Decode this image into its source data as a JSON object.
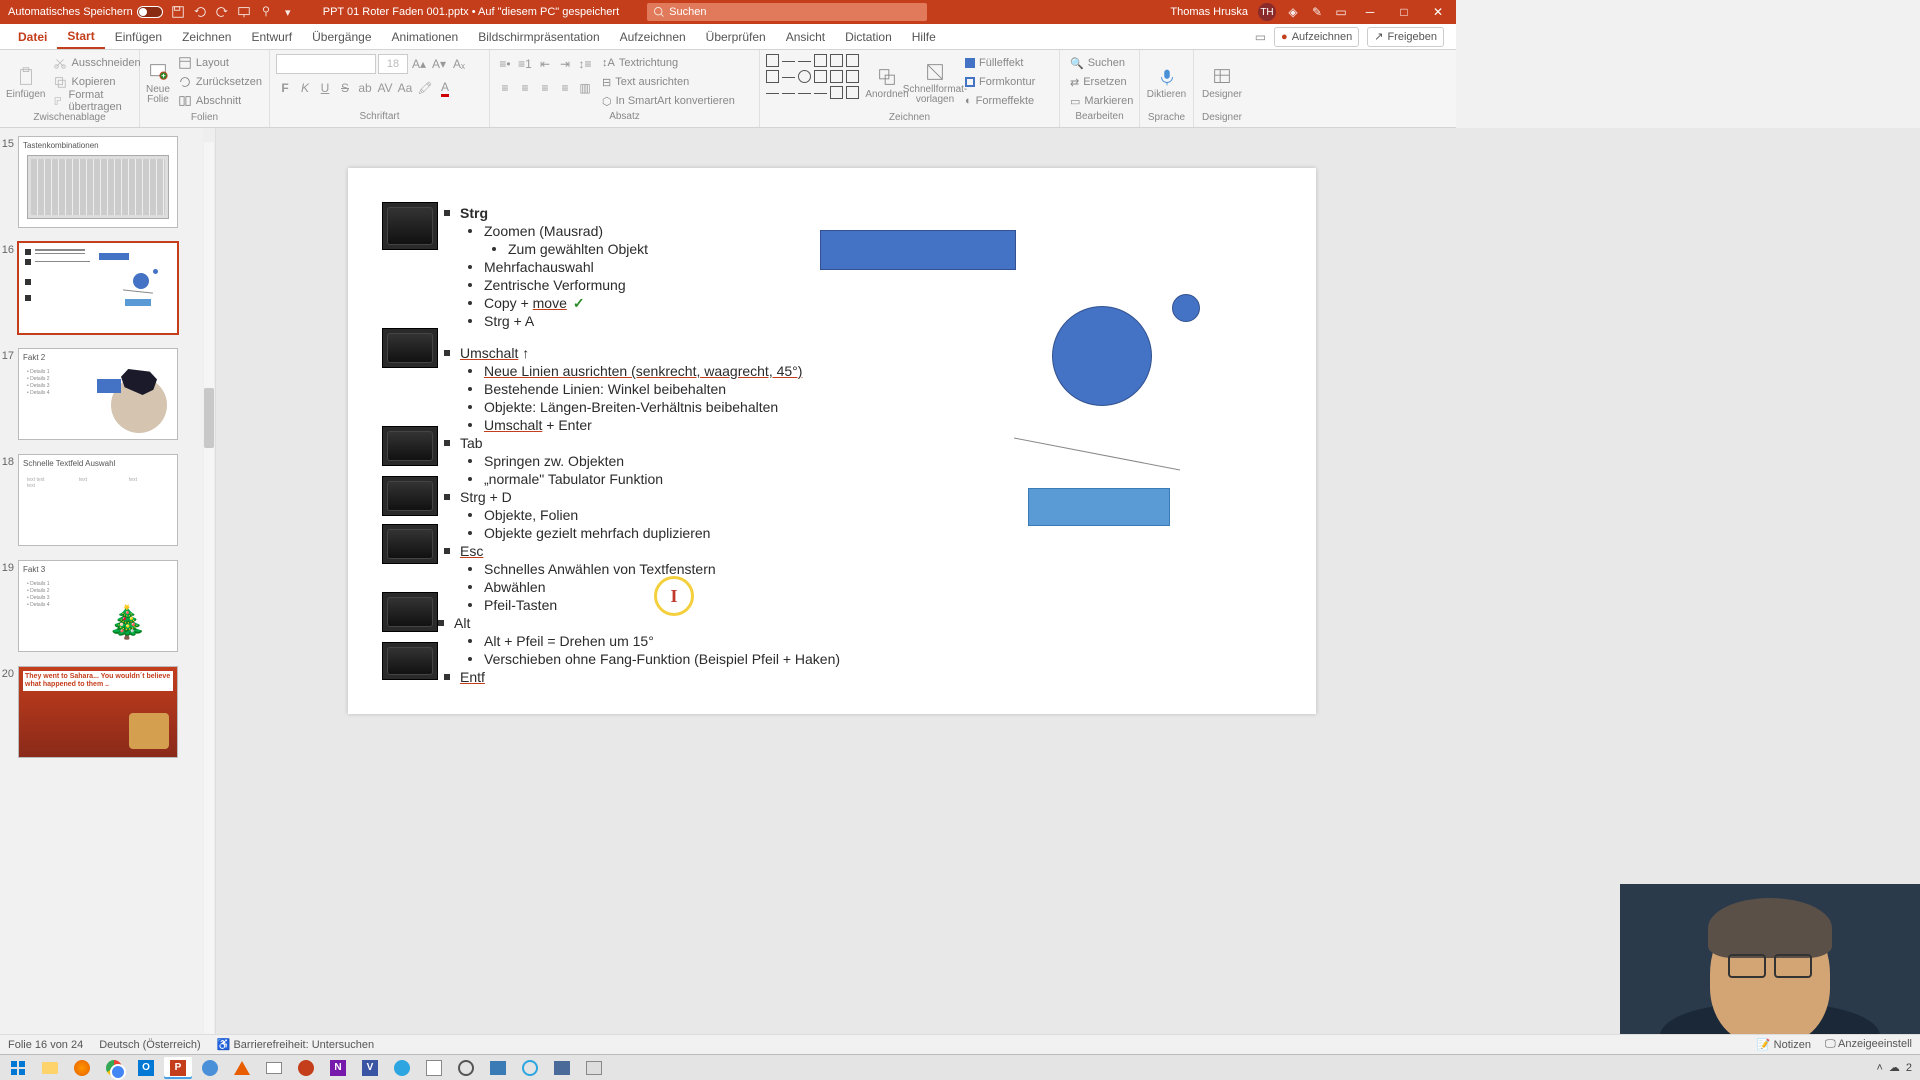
{
  "titlebar": {
    "autosave": "Automatisches Speichern",
    "doc": "PPT 01 Roter Faden 001.pptx • Auf \"diesem PC\" gespeichert",
    "search_placeholder": "Suchen",
    "user": "Thomas Hruska",
    "initials": "TH"
  },
  "tabs": {
    "file": "Datei",
    "start": "Start",
    "insert": "Einfügen",
    "draw": "Zeichnen",
    "design": "Entwurf",
    "transitions": "Übergänge",
    "animations": "Animationen",
    "slideshow": "Bildschirmpräsentation",
    "record": "Aufzeichnen",
    "review": "Überprüfen",
    "view": "Ansicht",
    "dictation": "Dictation",
    "help": "Hilfe",
    "rec_btn": "Aufzeichnen",
    "share": "Freigeben"
  },
  "ribbon": {
    "paste": "Einfügen",
    "cut": "Ausschneiden",
    "copy": "Kopieren",
    "format_painter": "Format übertragen",
    "clipboard": "Zwischenablage",
    "new_slide": "Neue Folie",
    "layout": "Layout",
    "reset": "Zurücksetzen",
    "section": "Abschnitt",
    "slides": "Folien",
    "font_size": "18",
    "font": "Schriftart",
    "text_dir": "Textrichtung",
    "text_align": "Text ausrichten",
    "smartart": "In SmartArt konvertieren",
    "paragraph": "Absatz",
    "arrange": "Anordnen",
    "quickstyles": "Schnellformat-vorlagen",
    "shape_fill": "Fülleffekt",
    "shape_outline": "Formkontur",
    "shape_effects": "Formeffekte",
    "drawing": "Zeichnen",
    "find": "Suchen",
    "replace": "Ersetzen",
    "select": "Markieren",
    "editing": "Bearbeiten",
    "dictate": "Diktieren",
    "voice": "Sprache",
    "designer": "Designer"
  },
  "thumbs": {
    "15": {
      "title": "Tastenkombinationen"
    },
    "17": {
      "title": "Fakt 2"
    },
    "18": {
      "title": "Schnelle Textfeld Auswahl"
    },
    "19": {
      "title": "Fakt 3"
    },
    "20": {
      "title": "They went to Sahara... You wouldn´t believe what happened to them .."
    }
  },
  "slide": {
    "strg": "Strg",
    "strg_items": {
      "zoom": "Zoomen (Mausrad)",
      "zoom_obj": "Zum gewählten Objekt",
      "multi": "Mehrfachauswahl",
      "zentr": "Zentrische Verformung",
      "copy": "Copy + ",
      "move": "move",
      "strga": "Strg + A"
    },
    "shift": "Umschalt",
    "shift_arrow": "↑",
    "shift_items": {
      "lines": "Neue Linien ausrichten (senkrecht, waagrecht, 45°)",
      "exist": "Bestehende Linien: Winkel beibehalten",
      "obj": "Objekte: Längen-Breiten-Verhältnis beibehalten",
      "enter_a": "Umschalt",
      "enter_b": " + Enter"
    },
    "tab": "Tab",
    "tab_items": {
      "jump": "Springen zw. Objekten",
      "normal": "„normale\" Tabulator Funktion"
    },
    "strgd": "Strg + D",
    "strgd_items": {
      "obj": "Objekte, Folien",
      "dup": "Objekte gezielt mehrfach duplizieren"
    },
    "esc": "Esc",
    "esc_items": {
      "sel": "Schnelles Anwählen von Textfenstern",
      "desel": "Abwählen",
      "arrow": "Pfeil-Tasten"
    },
    "alt": "Alt",
    "alt_items": {
      "rot": "Alt + Pfeil = Drehen um 15°",
      "move": "Verschieben ohne Fang-Funktion (Beispiel Pfeil + Haken)"
    },
    "entf": "Entf"
  },
  "status": {
    "slide": "Folie 16 von 24",
    "lang": "Deutsch (Österreich)",
    "access": "Barrierefreiheit: Untersuchen",
    "notes": "Notizen",
    "display": "Anzeigeeinstell"
  },
  "tray": {
    "temp": "2"
  }
}
